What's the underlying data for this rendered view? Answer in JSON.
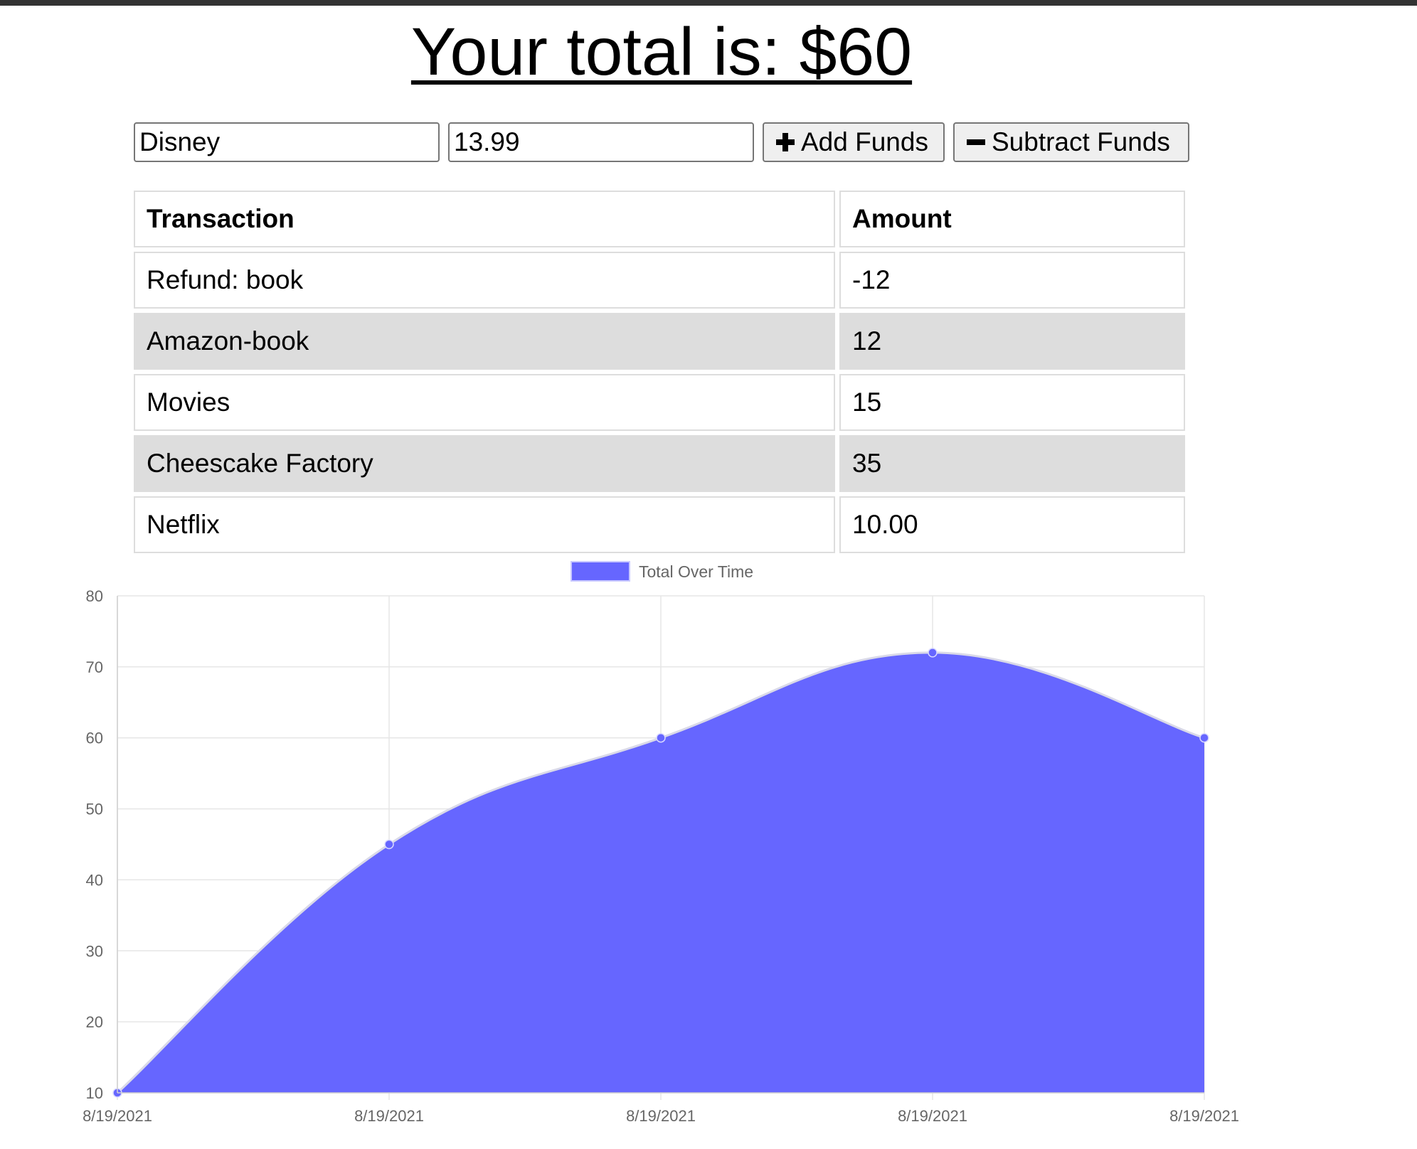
{
  "header": {
    "title": "Your total is: $60"
  },
  "form": {
    "name_value": "Disney",
    "amount_value": "13.99",
    "add_label": "Add Funds",
    "subtract_label": "Subtract Funds",
    "add_icon": "plus-icon",
    "subtract_icon": "minus-icon"
  },
  "table": {
    "headers": [
      "Transaction",
      "Amount"
    ],
    "rows": [
      {
        "name": "Refund: book",
        "amount": "-12"
      },
      {
        "name": "Amazon-book",
        "amount": "12"
      },
      {
        "name": "Movies",
        "amount": "15"
      },
      {
        "name": "Cheescake Factory",
        "amount": "35"
      },
      {
        "name": "Netflix",
        "amount": "10.00"
      }
    ]
  },
  "chart_data": {
    "type": "area",
    "x": [
      "8/19/2021",
      "8/19/2021",
      "8/19/2021",
      "8/19/2021",
      "8/19/2021"
    ],
    "series": [
      {
        "name": "Total Over Time",
        "values": [
          10,
          45,
          60,
          72,
          60
        ],
        "color": "#6666ff"
      }
    ],
    "ylim": [
      10,
      80
    ],
    "yticks": [
      10,
      20,
      30,
      40,
      50,
      60,
      70,
      80
    ],
    "grid": true,
    "legend_position": "top-center"
  }
}
